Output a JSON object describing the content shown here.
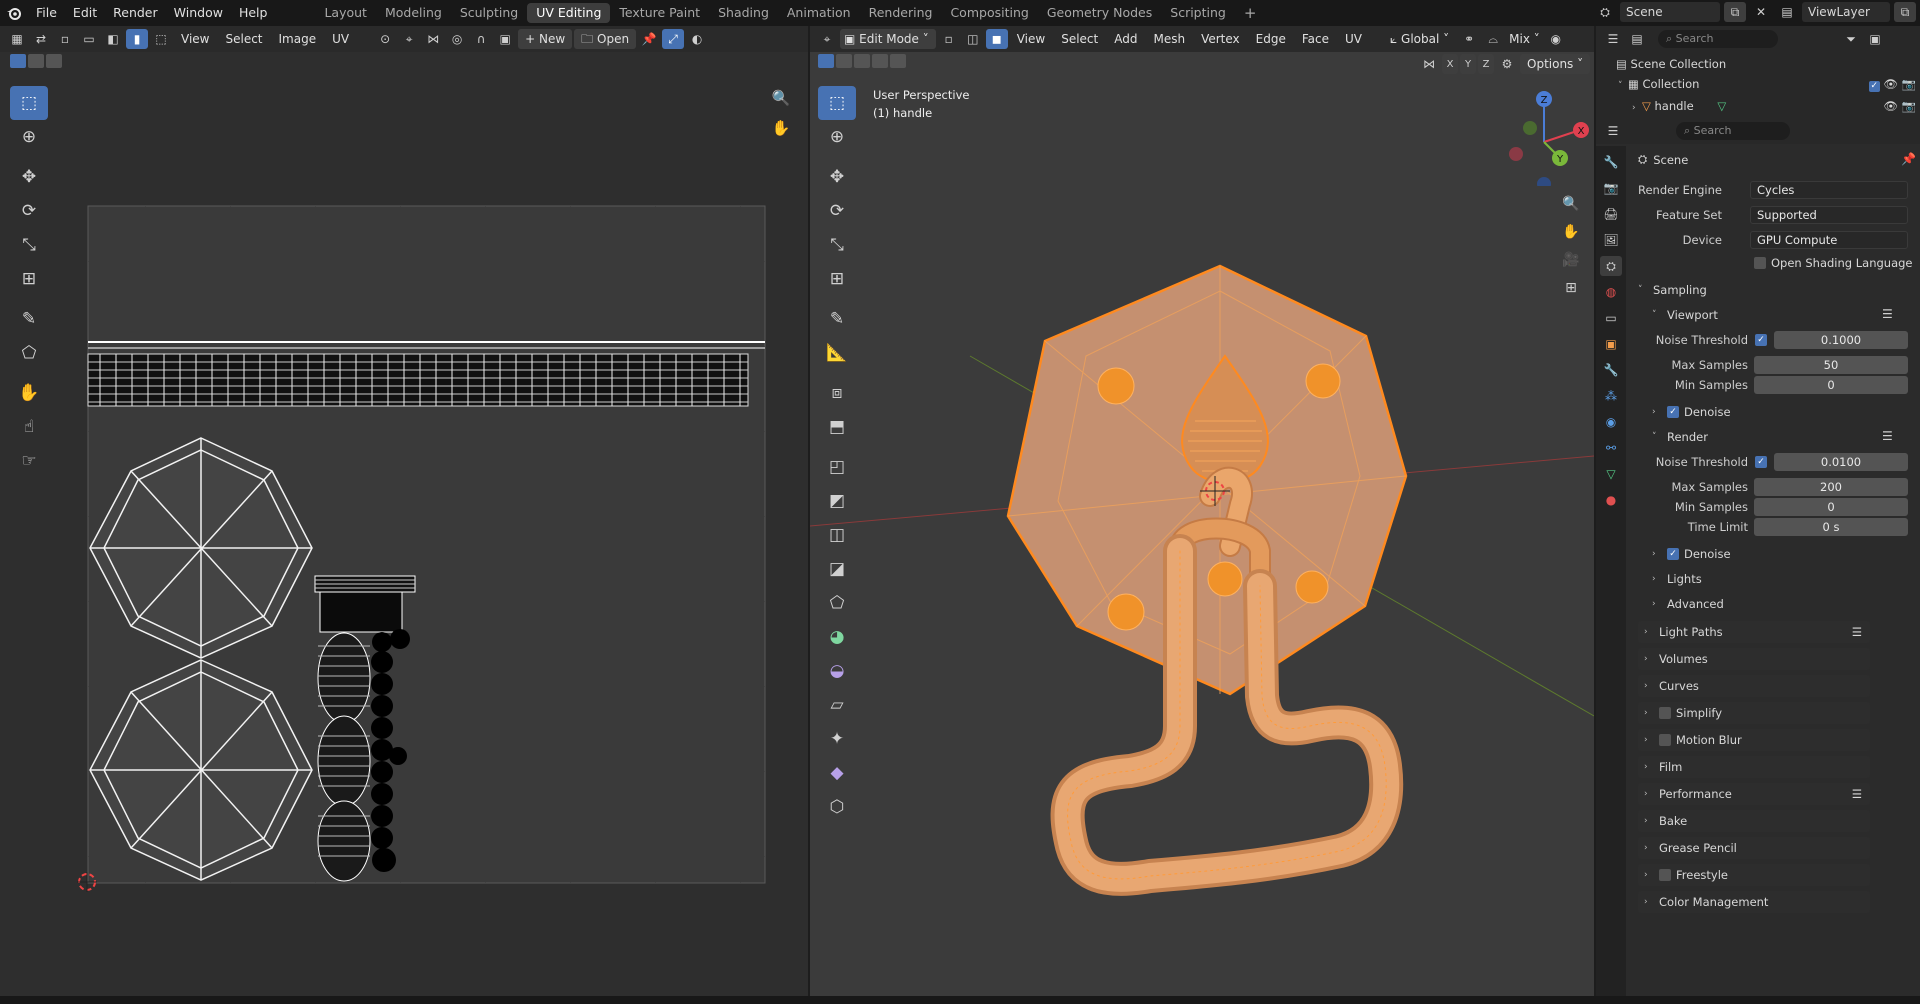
{
  "app_menu": [
    "File",
    "Edit",
    "Render",
    "Window",
    "Help"
  ],
  "workspaces": [
    {
      "label": "Layout",
      "active": false
    },
    {
      "label": "Modeling",
      "active": false
    },
    {
      "label": "Sculpting",
      "active": false
    },
    {
      "label": "UV Editing",
      "active": true
    },
    {
      "label": "Texture Paint",
      "active": false
    },
    {
      "label": "Shading",
      "active": false
    },
    {
      "label": "Animation",
      "active": false
    },
    {
      "label": "Rendering",
      "active": false
    },
    {
      "label": "Compositing",
      "active": false
    },
    {
      "label": "Geometry Nodes",
      "active": false
    },
    {
      "label": "Scripting",
      "active": false
    }
  ],
  "add_workspace_icon": "plus-icon",
  "top_right": {
    "scene_label": "Scene",
    "view_layer_label": "ViewLayer"
  },
  "uv_editor": {
    "menus": [
      "View",
      "Select",
      "Image",
      "UV"
    ],
    "new_label": "New",
    "open_label": "Open"
  },
  "viewport": {
    "mode_label": "Edit Mode",
    "menus": [
      "View",
      "Select",
      "Add",
      "Mesh",
      "Vertex",
      "Edge",
      "Face",
      "UV"
    ],
    "orientation_label": "Global",
    "shading_label": "Mix",
    "options_label": "Options",
    "axes": [
      "X",
      "Y",
      "Z"
    ],
    "overlay_line1": "User Perspective",
    "overlay_line2": "(1) handle",
    "gizmo_axes": [
      "Z",
      "X",
      "Y"
    ]
  },
  "outliner": {
    "search_placeholder": "Search",
    "scene_collection": "Scene Collection",
    "collection": "Collection",
    "object": "handle"
  },
  "properties": {
    "search_placeholder": "Search",
    "context_title": "Scene",
    "render_engine_label": "Render Engine",
    "render_engine_value": "Cycles",
    "feature_set_label": "Feature Set",
    "feature_set_value": "Supported",
    "device_label": "Device",
    "device_value": "GPU Compute",
    "osl_label": "Open Shading Language",
    "sampling_label": "Sampling",
    "viewport_label": "Viewport",
    "vp_noise_label": "Noise Threshold",
    "vp_noise_value": "0.1000",
    "vp_max_label": "Max Samples",
    "vp_max_value": "50",
    "vp_min_label": "Min Samples",
    "vp_min_value": "0",
    "vp_denoise_label": "Denoise",
    "render_label": "Render",
    "r_noise_label": "Noise Threshold",
    "r_noise_value": "0.0100",
    "r_max_label": "Max Samples",
    "r_max_value": "200",
    "r_min_label": "Min Samples",
    "r_min_value": "0",
    "r_time_label": "Time Limit",
    "r_time_value": "0 s",
    "r_denoise_label": "Denoise",
    "lights_label": "Lights",
    "advanced_label": "Advanced",
    "panels": [
      "Light Paths",
      "Volumes",
      "Curves",
      "Simplify",
      "Motion Blur",
      "Film",
      "Performance",
      "Bake",
      "Grease Pencil",
      "Freestyle",
      "Color Management"
    ]
  },
  "colors": {
    "accent": "#4772b3",
    "selection_orange": "#ff8a1f",
    "mesh_fill": "#c9906a"
  }
}
